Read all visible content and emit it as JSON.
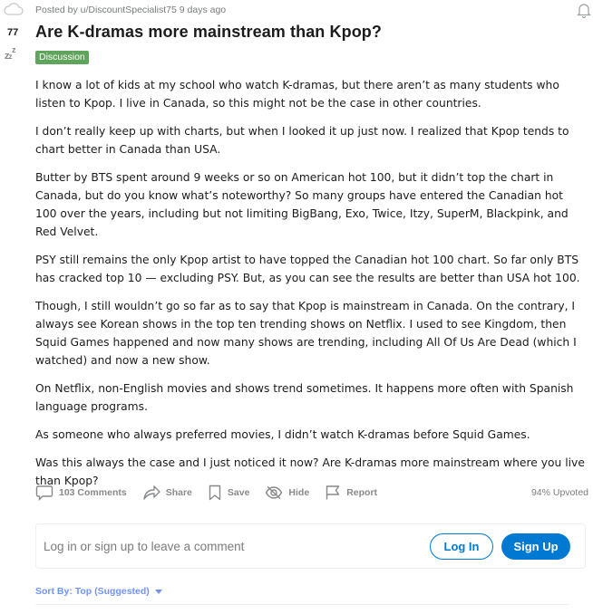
{
  "post": {
    "score": "77",
    "posted_by": "Posted by u/DiscountSpecialist75 9 days ago",
    "title": "Are K-dramas more mainstream than Kpop?",
    "flair": "Discussion",
    "flair_color": "#5fa45c",
    "paragraphs": [
      "I know a lot of kids at my school who watch K-dramas, but there aren’t as many students who listen to Kpop. I live in Canada, so this might not be the case in other countries.",
      "I don’t really keep up with charts, but when I looked it up just now. I realized that Kpop tends to chart better in Canada than USA.",
      "Butter by BTS spent around 9 weeks or so on American hot 100, but it didn’t top the chart in Canada, but do you know what’s noteworthy? So many groups have entered the Canadian hot 100 over the years, including but not limiting BigBang, Exo, Twice, Itzy, SuperM, Blackpink, and Red Velvet.",
      "PSY still remains the only Kpop artist to have topped the Canadian hot 100 chart. So far only BTS has cracked top 10 — excluding PSY. But, as you can see the results are better than USA hot 100.",
      "Though, I still wouldn’t go so far as to say that Kpop is mainstream in Canada. On the contrary, I always see Korean shows in the top ten trending shows on Netflix. I used to see Kingdom, then Squid Games happened and now many shows are trending, including All Of Us Are Dead (which I watched) and now a new show.",
      "On Netflix, non-English movies and shows trend sometimes. It happens more often with Spanish language programs.",
      "As someone who always preferred movies, I didn’t watch K-dramas before Squid Games.",
      "Was this always the case and I just noticed it now? Are K-dramas more mainstream where you live than Kpop?"
    ]
  },
  "actions": {
    "comments": "103 Comments",
    "share": "Share",
    "save": "Save",
    "hide": "Hide",
    "report": "Report",
    "upvoted": "94% Upvoted"
  },
  "comment_box": {
    "prompt": "Log in or sign up to leave a comment",
    "login": "Log In",
    "signup": "Sign Up"
  },
  "sort": {
    "label": "Sort By: Top (Suggested)"
  },
  "icons": {
    "avatar": "cloud-icon",
    "sleep": "zzz-icon",
    "notify": "bell-icon",
    "comments": "comment-bubble-icon",
    "share": "share-arrow-icon",
    "save": "bookmark-icon",
    "hide": "eye-slash-icon",
    "report": "flag-icon",
    "sort": "caret-down-icon"
  },
  "colors": {
    "accent": "#0079d3",
    "sort": "#7193ff",
    "muted": "#878a8c"
  }
}
